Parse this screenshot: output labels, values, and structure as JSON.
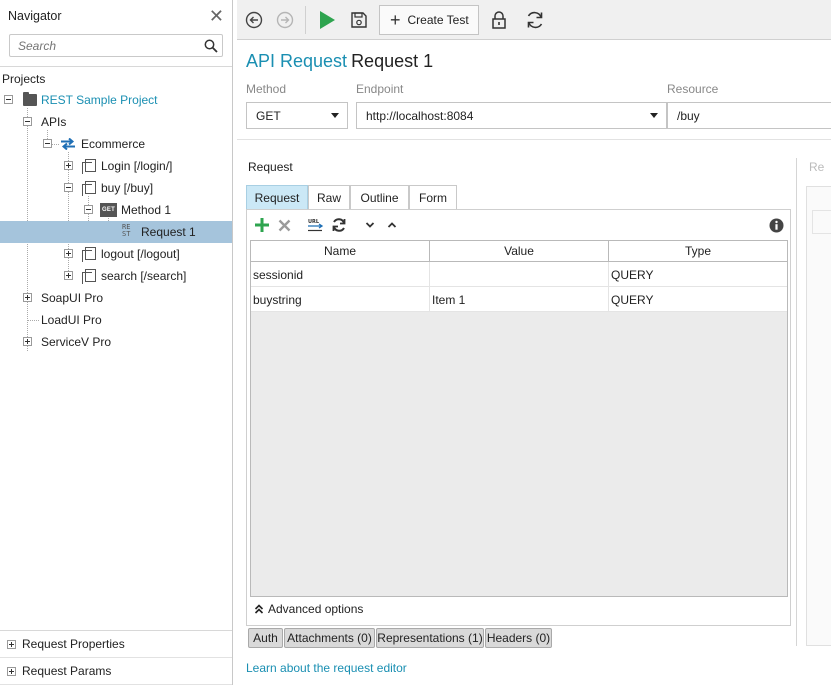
{
  "navigator": {
    "title": "Navigator",
    "search_placeholder": "Search",
    "projects_label": "Projects",
    "tree": [
      {
        "label": "REST Sample Project"
      },
      {
        "label": "APIs"
      },
      {
        "label": "Ecommerce"
      },
      {
        "label": "Login [/login/]"
      },
      {
        "label": "buy [/buy]"
      },
      {
        "label": "Method 1",
        "icon_text": "GET"
      },
      {
        "label": "Request 1",
        "icon_text_1": "RE",
        "icon_text_2": "ST"
      },
      {
        "label": "logout [/logout]"
      },
      {
        "label": "search [/search]"
      },
      {
        "label": "SoapUI Pro"
      },
      {
        "label": "LoadUI Pro"
      },
      {
        "label": "ServiceV Pro"
      }
    ],
    "bottom": [
      {
        "label": "Request Properties"
      },
      {
        "label": "Request Params"
      }
    ]
  },
  "toolbar": {
    "create_test_label": "Create Test"
  },
  "editor": {
    "title_type": "API Request",
    "title_name": "Request 1",
    "method_label": "Method",
    "method_value": "GET",
    "endpoint_label": "Endpoint",
    "endpoint_value": "http://localhost:8084",
    "resource_label": "Resource",
    "resource_value": "/buy"
  },
  "request": {
    "section_label": "Request",
    "right_panel_label_partial": "Re",
    "tabs": [
      {
        "label": "Request"
      },
      {
        "label": "Raw"
      },
      {
        "label": "Outline"
      },
      {
        "label": "Form"
      }
    ],
    "table": {
      "columns": [
        "Name",
        "Value",
        "Type"
      ],
      "rows": [
        {
          "name": "sessionid",
          "value": "",
          "type": "QUERY"
        },
        {
          "name": "buystring",
          "value": "Item 1",
          "type": "QUERY"
        }
      ]
    },
    "advanced_label": "Advanced options",
    "bottom_tabs": [
      {
        "label": "Auth"
      },
      {
        "label": "Attachments (0)"
      },
      {
        "label": "Representations (1)"
      },
      {
        "label": "Headers (0)"
      }
    ],
    "learn_link": "Learn about the request editor"
  },
  "colors": {
    "accent": "#1a8fb2",
    "selection": "#a5c4dc",
    "active_tab": "#cbe8f6",
    "run_green": "#2ea44f"
  }
}
